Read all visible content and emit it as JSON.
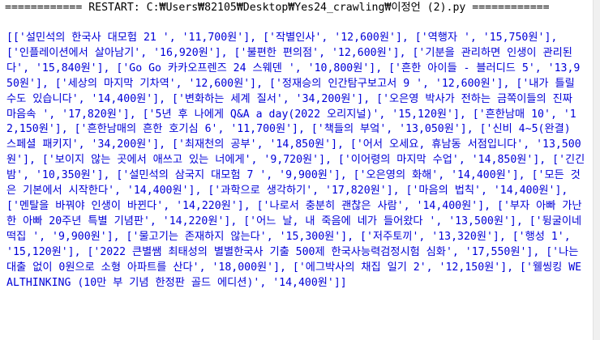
{
  "shell": {
    "restart_line": "============ RESTART: C:₩Users₩82105₩Desktop₩Yes24_crawling₩이정언 (2).py ============",
    "output_text": "[['설민석의 한국사 대모험 21 ', '11,700원'], ['작별인사', '12,600원'], ['역행자 ', '15,750원'], ['인플레이션에서 살아남기', '16,920원'], ['불편한 편의점', '12,600원'], ['기분을 관리하면 인생이 관리된다', '15,840원'], ['Go Go 카카오프렌즈 24 스웨덴 ', '10,800원'], ['흔한 아이들 - 블러디드 5', '13,950원'], ['세상의 마지막 기차역', '12,600원'], ['정재승의 인간탐구보고서 9 ', '12,600원'], ['내가 틀릴 수도 있습니다', '14,400원'], ['변화하는 세계 질서', '34,200원'], ['오은영 박사가 전하는 금쪽이들의 진짜 마음속 ', '17,820원'], ['5년 후 나에게 Q&A a day(2022 오리지널)', '15,120원'], ['흔한남매 10', '12,150원'], ['흔한남매의 흔한 호기심 6', '11,700원'], ['책들의 부엌', '13,050원'], ['신비 4~5(완결) 스페셜 패키지', '34,200원'], ['최재천의 공부', '14,850원'], ['어서 오세요, 휴남동 서점입니다', '13,500원'], ['보이지 않는 곳에서 애쓰고 있는 너에게', '9,720원'], ['이어령의 마지막 수업', '14,850원'], ['긴긴밤', '10,350원'], ['설민석의 삼국지 대모험 7 ', '9,900원'], ['오은영의 화해', '14,400원'], ['모든 것은 기본에서 시작한다', '14,400원'], ['과학으로 생각하기', '17,820원'], ['마음의 법칙', '14,400원'], ['멘탈을 바꿔야 인생이 바뀐다', '14,220원'], ['나로서 충분히 괜찮은 사람', '14,400원'], ['부자 아빠 가난한 아빠 20주년 특별 기념판', '14,220원'], ['어느 날, 내 죽음에 네가 들어왔다 ', '13,500원'], ['뒹굴이네 떡집 ', '9,900원'], ['물고기는 존재하지 않는다', '15,300원'], ['저주토끼', '13,320원'], ['행성 1', '15,120원'], ['2022 큰별쌤 최태성의 별별한국사 기출 500제 한국사능력검정시험 심화', '17,550원'], ['나는 대출 없이 0원으로 소형 아파트를 산다', '18,000원'], ['에그박사의 채집 일기 2', '12,150원'], ['웰씽킹 WEALTHINKING (10만 부 기념 한정판 골드 에디션)', '14,400원']]"
  },
  "colors": {
    "output_text": "#0000d8",
    "restart_text": "#000000",
    "background": "#ffffff",
    "scrollbar": "#f0f0f0"
  }
}
